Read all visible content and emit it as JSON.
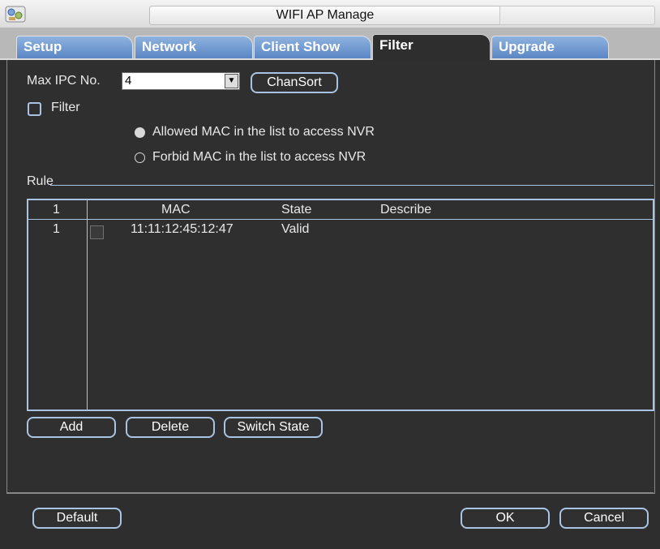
{
  "window": {
    "title": "WIFI AP Manage"
  },
  "tabs": [
    {
      "label": "Setup",
      "active": false
    },
    {
      "label": "Network",
      "active": false
    },
    {
      "label": "Client Show",
      "active": false
    },
    {
      "label": "Filter",
      "active": true
    },
    {
      "label": "Upgrade",
      "active": false
    }
  ],
  "filter": {
    "max_ipc_label": "Max IPC No.",
    "max_ipc_value": "4",
    "chansort_label": "ChanSort",
    "filter_label": "Filter",
    "filter_checked": false,
    "radio_allowed": {
      "label": "Allowed MAC in the list to access NVR",
      "selected": true
    },
    "radio_forbid": {
      "label": "Forbid MAC in the list to access NVR",
      "selected": false
    }
  },
  "rule": {
    "label": "Rule",
    "columns": [
      "1",
      "MAC",
      "State",
      "Describe"
    ],
    "rows": [
      {
        "index": "1",
        "mac": "11:11:12:45:12:47",
        "state": "Valid",
        "describe": ""
      }
    ]
  },
  "actions": {
    "add": "Add",
    "delete": "Delete",
    "switch_state": "Switch State"
  },
  "footer": {
    "default": "Default",
    "ok": "OK",
    "cancel": "Cancel"
  },
  "colors": {
    "accent": "#a9c3e2",
    "background": "#2f2f2f",
    "tab_blue": "#6f98d0"
  }
}
